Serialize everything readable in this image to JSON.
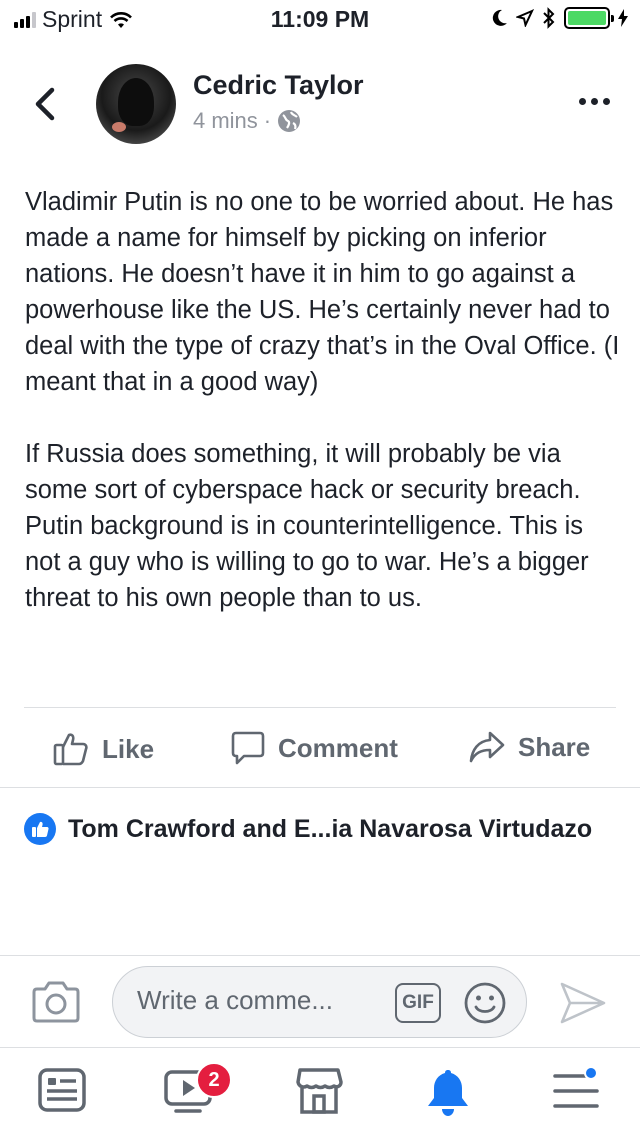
{
  "status_bar": {
    "carrier": "Sprint",
    "time": "11:09 PM",
    "battery_color": "#4cd964"
  },
  "header": {
    "back_icon": "chevron-left-icon",
    "author_name": "Cedric Taylor",
    "timestamp": "4 mins",
    "separator": "·",
    "privacy_icon": "globe-icon",
    "more_icon": "more-horizontal-icon"
  },
  "post": {
    "paragraphs": [
      "Vladimir Putin is no one to be worried about. He has made a name for himself by picking on inferior nations. He doesn’t have it in him to go against a powerhouse like the US.  He’s certainly never had to deal with the type of crazy that’s in the Oval Office. (I meant that in a good way)",
      "If Russia does something, it will probably be via some sort of cyberspace hack or security breach. Putin background is in counterintelligence. This is not a guy who is willing to go to war. He’s a bigger threat to his own people than to us."
    ]
  },
  "actions": {
    "like_label": "Like",
    "comment_label": "Comment",
    "share_label": "Share"
  },
  "reactions": {
    "text": "Tom Crawford and E...ia Navarosa Virtudazo",
    "reaction_color": "#1877f2"
  },
  "composer": {
    "placeholder": "Write a comme...",
    "gif_label": "GIF"
  },
  "tab_bar": {
    "items": [
      {
        "name": "news-feed",
        "icon": "news-feed-icon",
        "active": false
      },
      {
        "name": "watch",
        "icon": "watch-video-icon",
        "active": false,
        "badge": "2"
      },
      {
        "name": "marketplace",
        "icon": "marketplace-icon",
        "active": false
      },
      {
        "name": "notifications",
        "icon": "bell-icon",
        "active": true
      },
      {
        "name": "menu",
        "icon": "menu-icon",
        "active": false
      }
    ],
    "active_color": "#1877f2",
    "badge_color": "#e41e3f"
  }
}
